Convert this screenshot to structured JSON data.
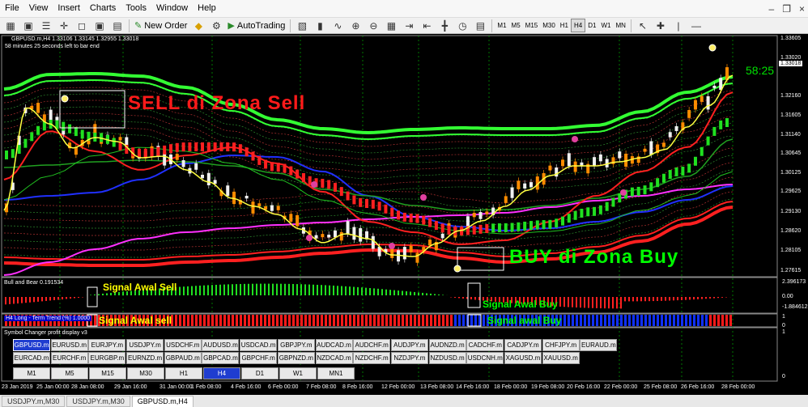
{
  "menu": [
    "File",
    "View",
    "Insert",
    "Charts",
    "Tools",
    "Window",
    "Help"
  ],
  "toolbar": {
    "new_order": "New Order",
    "autotrading": "AutoTrading",
    "timeframes": [
      "M1",
      "M5",
      "M15",
      "M30",
      "H1",
      "H4",
      "D1",
      "W1",
      "MN"
    ],
    "active_timeframe": "H4"
  },
  "chart": {
    "header1": "GBPUSD.m,H4  1.33106 1.33145 1.32955 1.33018",
    "header2": "58 minutes 25 seconds left to bar end",
    "countdown": "58:25",
    "sell_zone": "SELL di Zona Sell",
    "buy_zone": "BUY di Zona Buy",
    "current_price": "1.33018",
    "price_ticks": [
      "1.33605",
      "1.33020",
      "1.32160",
      "1.31605",
      "1.31140",
      "1.30645",
      "1.30125",
      "1.29625",
      "1.29130",
      "1.28620",
      "1.28105",
      "1.27615"
    ],
    "time_ticks": [
      "23 Jan 2019",
      "25 Jan 00:00",
      "28 Jan 08:00",
      "29 Jan 16:00",
      "31 Jan 00:00",
      "1 Feb 08:00",
      "4 Feb 16:00",
      "6 Feb 00:00",
      "7 Feb 08:00",
      "8 Feb 16:00",
      "12 Feb 00:00",
      "13 Feb 08:00",
      "14 Feb 16:00",
      "18 Feb 00:00",
      "19 Feb 08:00",
      "20 Feb 16:00",
      "22 Feb 00:00",
      "25 Feb 08:00",
      "26 Feb 16:00",
      "28 Feb 00:00"
    ]
  },
  "indicators": {
    "bull_bear_label": "Bull and Bear 0.191534",
    "bull_bear_max": "2.396173",
    "bull_bear_zero": "0.00",
    "bull_bear_min": "-1.884612",
    "signal_sell_1": "Signal Awal Sell",
    "signal_buy_1": "Signal Awal Buy",
    "long_term_label": "H4 Long - Term Trend (%) 1.0000",
    "long_term_max": "1",
    "long_term_min": "0",
    "signal_sell_2": "Signal Awal sell",
    "signal_buy_2": "Signal awal Buy",
    "symbol_changer_label": "Symbol Changer profit display v3",
    "symbol_changer_max": "1",
    "symbol_changer_min": "0"
  },
  "symbol_changer": {
    "pairs": [
      "GBPUSD.m",
      "EURUSD.m",
      "EURJPY.m",
      "USDJPY.m",
      "USDCHF.m",
      "AUDUSD.m",
      "USDCAD.m",
      "GBPJPY.m",
      "AUDCAD.m",
      "AUDCHF.m",
      "AUDJPY.m",
      "AUDNZD.m",
      "CADCHF.m",
      "CADJPY.m",
      "CHFJPY.m",
      "EURAUD.m",
      "EURCAD.m",
      "EURCHF.m",
      "EURGBP.m",
      "EURNZD.m",
      "GBPAUD.m",
      "GBPCAD.m",
      "GBPCHF.m",
      "GBPNZD.m",
      "NZDCAD.m",
      "NZDCHF.m",
      "NZDJPY.m",
      "NZDUSD.m",
      "USDCNH.m",
      "XAGUSD.m",
      "XAUUSD.m"
    ],
    "active_pair": "GBPUSD.m",
    "timeframes": [
      "M1",
      "M5",
      "M15",
      "M30",
      "H1",
      "H4",
      "D1",
      "W1",
      "MN1"
    ],
    "active_timeframe": "H4"
  },
  "tabs": [
    "USDJPY.m,M30",
    "USDJPY.m,M30",
    "GBPUSD.m,H4"
  ],
  "active_tab": "GBPUSD.m,H4"
}
